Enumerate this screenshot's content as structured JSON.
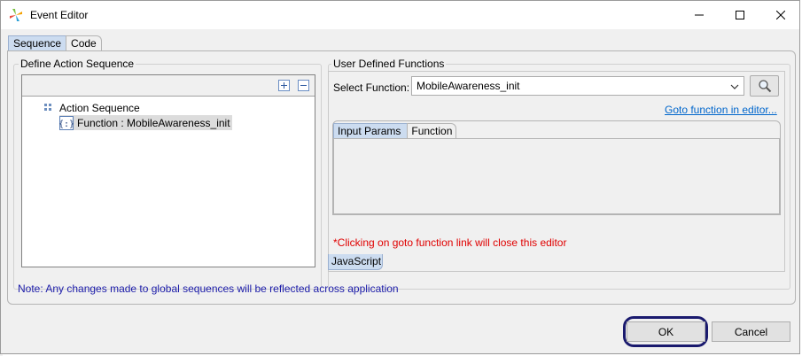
{
  "window": {
    "title": "Event Editor"
  },
  "outer_tabs": [
    {
      "label": "Sequence",
      "active": true
    },
    {
      "label": "Code",
      "active": false
    }
  ],
  "left_panel": {
    "group_label": "Define Action Sequence",
    "tree": [
      {
        "label": "Action Sequence",
        "icon": "sequence-icon",
        "level": 0,
        "selected": false
      },
      {
        "label": "Function : MobileAwareness_init",
        "icon": "function-braces-icon",
        "level": 1,
        "selected": true
      }
    ]
  },
  "right_panel": {
    "group_label": "User Defined Functions",
    "select_label": "Select Function:",
    "select_value": "MobileAwareness_init",
    "goto_link": "Goto function in editor...",
    "inner_tabs": [
      {
        "label": "Input Params",
        "active": true
      },
      {
        "label": "Function",
        "active": false
      }
    ],
    "warning": "*Clicking on goto function link will close this editor",
    "bottom_tab": "JavaScript"
  },
  "note": "Note: Any changes made to global sequences will be reflected across application",
  "buttons": {
    "ok": "OK",
    "cancel": "Cancel"
  },
  "colors": {
    "accent_tab": "#ccdcf0",
    "link": "#0066cc",
    "warning": "#e00000",
    "note": "#1a1aa8",
    "focus_ring": "#1a1a6e"
  }
}
